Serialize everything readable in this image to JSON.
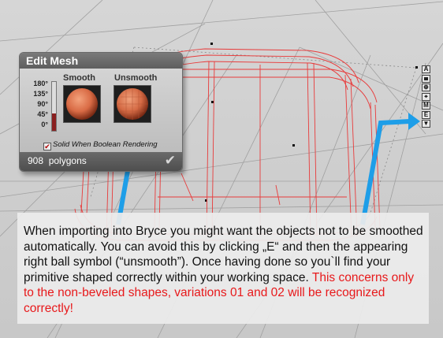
{
  "edit_mesh": {
    "title": "Edit Mesh",
    "smooth_label": "Smooth",
    "unsmooth_label": "Unsmooth",
    "angles": [
      "180°",
      "135°",
      "90°",
      "45°",
      "0°"
    ],
    "smoothing_level": 0.35,
    "solid_label": "Solid When Boolean Rendering",
    "solid_checked": true,
    "polygon_count": "908",
    "polygon_unit": "polygons",
    "check_icon": "checkmark-icon"
  },
  "toolbar": {
    "buttons": [
      {
        "label": "A",
        "icon": "a-icon"
      },
      {
        "label": "",
        "icon": "solid-square-icon"
      },
      {
        "label": "",
        "icon": "link-icon"
      },
      {
        "label": "",
        "icon": "target-icon"
      },
      {
        "label": "M",
        "icon": "m-icon"
      },
      {
        "label": "E",
        "icon": "e-icon"
      },
      {
        "label": "",
        "icon": "down-arrow-icon"
      }
    ]
  },
  "caption": {
    "main": "When importing into Bryce you might want the objects not to be smoothed automatically. You can avoid this by clicking „E“ and then the appearing right ball symbol (“unsmooth”). Once having done so you`ll find your primitive shaped correctly within your working space.",
    "note": "This concerns only to the non-beveled shapes, variations 01 and 02 will be recognized correctly!"
  },
  "colors": {
    "wireframe": "#e83b3b",
    "arrow": "#1e9ee8",
    "note": "#e8191b",
    "panel_header": "#5e5e5e"
  }
}
